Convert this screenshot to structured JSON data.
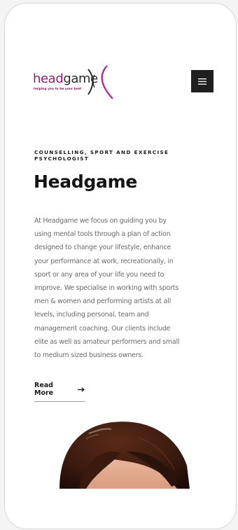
{
  "brand": {
    "logo_word_1": "head",
    "logo_word_2": "game",
    "tagline": "helping you to be your best",
    "accent_color": "#8b1f6c"
  },
  "header": {
    "menu_icon": "hamburger-menu-icon"
  },
  "hero": {
    "kicker": "COUNSELLING, SPORT AND EXERCISE PSYCHOLOGIST",
    "title": "Headgame",
    "lines": [
      "At Headgame we focus on guiding you by",
      "using mental tools through a plan of action",
      "designed to change your lifestyle, enhance",
      "your performance at work, recreationally, in",
      "sport or any area of your life you need to",
      "improve. We specialise in working with sports",
      "men & women and performing artists at all",
      "levels, including personal, team and",
      "management coaching. Our clients include",
      "elite as well as amateur performers and small",
      "to medium sized business owners."
    ],
    "read_more_label": "Read More",
    "read_more_icon": "arrow-right-icon"
  },
  "image": {
    "subject": "woman-portrait-photo"
  }
}
